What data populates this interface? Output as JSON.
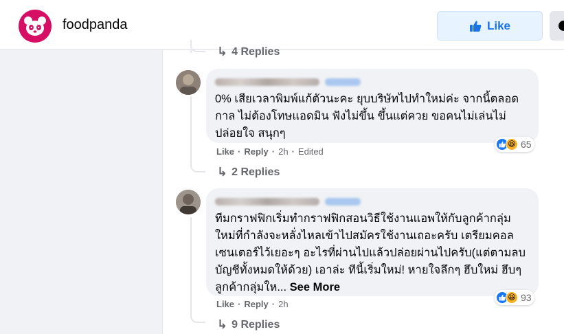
{
  "page": {
    "name": "foodpanda",
    "like_label": "Like",
    "colors": {
      "brand": "#d70f64",
      "like_text": "#1b74e4",
      "like_bg": "#e7f3ff"
    },
    "icons": [
      "foodpanda-logo",
      "thumbs-up-icon",
      "more-icon"
    ]
  },
  "replies_above": {
    "label": "4 Replies"
  },
  "comments": [
    {
      "text": "0% เสียเวลาพิมพ์แก้ตัวนะคะ ยุบบริษัทไปทำใหม่ค่ะ จากนี้ตลอดกาล ไม่ต้องโทษแอดมิน ฟังไม่ขึ้น ขึ้นแต่ควย ขอคนไม่เล่นไม่ปล่อยใจ สนุกๆ",
      "like_label": "Like",
      "reply_label": "Reply",
      "time": "2h",
      "edited": "Edited",
      "reaction_count": "65",
      "replies_label": "2 Replies"
    },
    {
      "text": "ทีมกราฟฟิกเริ่มทำกราฟฟิกสอนวิธีใช้งานแอพให้กับลูกค้ากลุ่มใหม่ที่กำลังจะหลั่งไหลเข้าไปสมัครใช้งานเถอะครับ เตรียมคอลเซนเตอร์ไว้เยอะๆ อะไรที่ผ่านไปแล้วปล่อยผ่านไปครับ(แต่ตามลบบัญชีทั้งหมดให้ด้วย) เอาล่ะ ทีนี้เริ่มใหม่! หายใจลึกๆ ฮึบใหม่ ฮึบๆ ลูกค้ากลุ่มให...",
      "see_more": "See More",
      "like_label": "Like",
      "reply_label": "Reply",
      "time": "2h",
      "reaction_count": "93",
      "replies_label": "9 Replies"
    }
  ]
}
